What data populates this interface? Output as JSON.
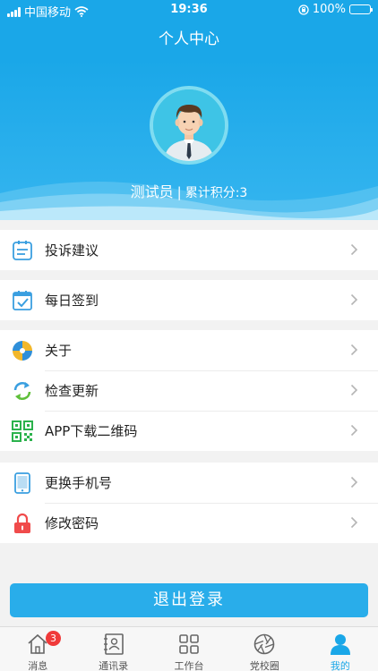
{
  "status_bar": {
    "carrier": "中国移动",
    "time": "19:36",
    "battery": "100%"
  },
  "nav": {
    "title": "个人中心"
  },
  "profile": {
    "name": "测试员",
    "separator": "|",
    "points_label": "累计积分:3"
  },
  "menu": {
    "complaint": "投诉建议",
    "checkin": "每日签到",
    "about": "关于",
    "update": "检查更新",
    "qrcode": "APP下载二维码",
    "change_phone": "更换手机号",
    "change_password": "修改密码"
  },
  "logout_label": "退出登录",
  "tabs": {
    "messages": "消息",
    "messages_badge": "3",
    "contacts": "通讯录",
    "workbench": "工作台",
    "campus": "党校圈",
    "mine": "我的"
  },
  "colors": {
    "primary": "#1aa7e8",
    "badge": "#f03a3a",
    "lock": "#f04b4b"
  }
}
